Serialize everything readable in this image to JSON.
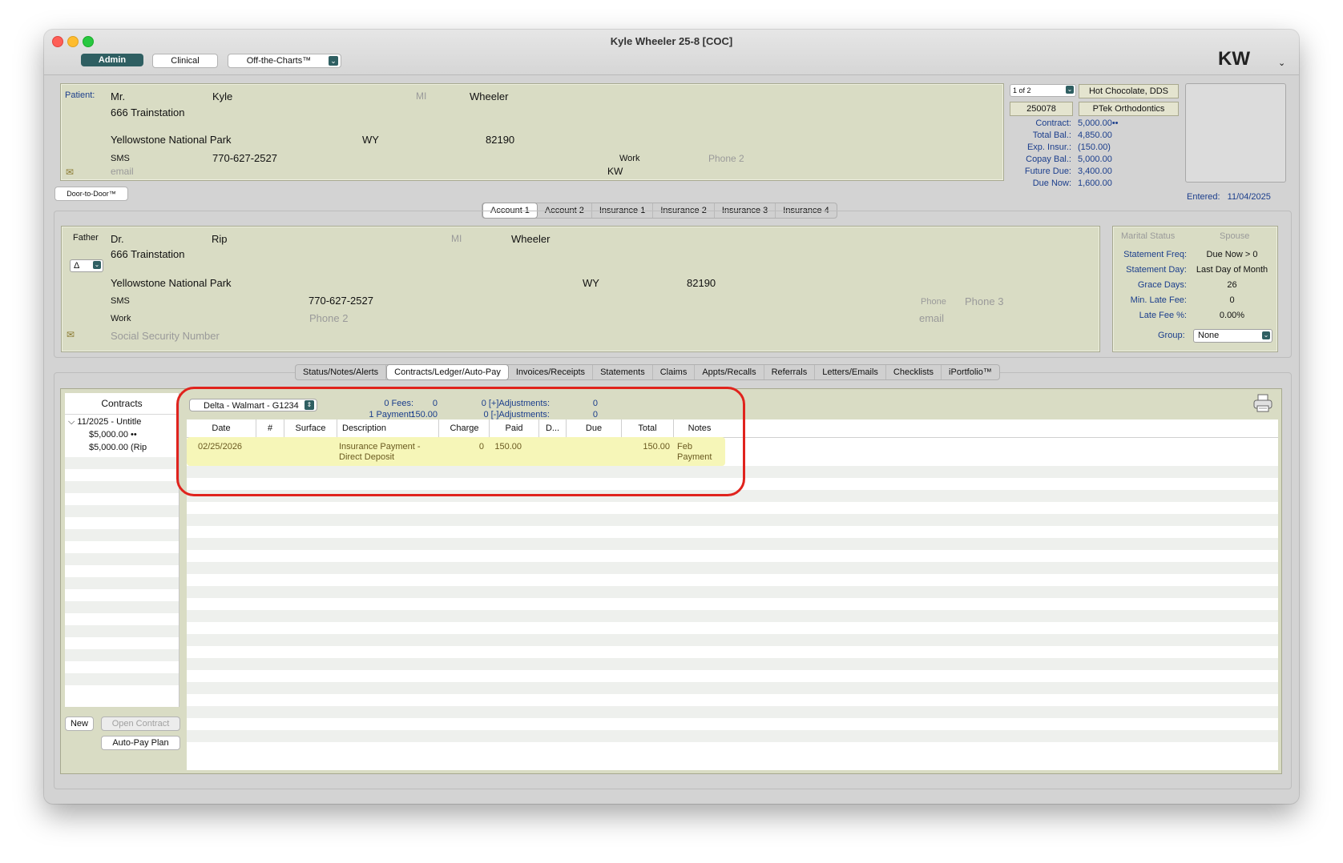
{
  "window": {
    "title": "Kyle Wheeler 25-8 [COC]",
    "initials": "KW"
  },
  "toolbar": {
    "admin": "Admin",
    "clinical": "Clinical",
    "otc": "Off-the-Charts™"
  },
  "patient": {
    "label": "Patient:",
    "prefix": "Mr.",
    "first": "Kyle",
    "mi": "MI",
    "last": "Wheeler",
    "address1": "666 Trainstation",
    "city": "Yellowstone National Park",
    "state": "WY",
    "zip": "82190",
    "sms_label": "SMS",
    "sms": "770-627-2527",
    "work_label": "Work",
    "phone2": "Phone 2",
    "email": "email",
    "initials": "KW"
  },
  "door_button": "Door-to-Door™",
  "account_info": {
    "count": "1 of 2",
    "account_no": "250078",
    "doctor": "Hot Chocolate, DDS",
    "practice": "PTek Orthodontics",
    "rows": [
      {
        "label": "Contract:",
        "value": "5,000.00••"
      },
      {
        "label": "Total Bal.:",
        "value": "4,850.00"
      },
      {
        "label": "Exp. Insur.:",
        "value": "(150.00)"
      },
      {
        "label": "Copay Bal.:",
        "value": "5,000.00"
      },
      {
        "label": "Future Due:",
        "value": "3,400.00"
      },
      {
        "label": "Due Now:",
        "value": "1,600.00"
      }
    ],
    "entered_label": "Entered:",
    "entered": "11/04/2025"
  },
  "account_tabs": [
    "Account 1",
    "Account 2",
    "Insurance 1",
    "Insurance 2",
    "Insurance 3",
    "Insurance 4"
  ],
  "responsible": {
    "relation": "Father",
    "prefix": "Dr.",
    "first": "Rip",
    "mi": "MI",
    "last": "Wheeler",
    "address1": "666 Trainstation",
    "delta": "Δ",
    "city": "Yellowstone National Park",
    "state": "WY",
    "zip": "82190",
    "sms_label": "SMS",
    "sms": "770-627-2527",
    "work_label": "Work",
    "phone2": "Phone 2",
    "phone_label": "Phone",
    "phone3": "Phone 3",
    "email": "email",
    "ssn": "Social Security Number"
  },
  "statement": {
    "marital": "Marital Status",
    "spouse": "Spouse",
    "rows": [
      {
        "label": "Statement Freq:",
        "value": "Due Now > 0"
      },
      {
        "label": "Statement Day:",
        "value": "Last Day of Month"
      },
      {
        "label": "Grace Days:",
        "value": "26"
      },
      {
        "label": "Min. Late Fee:",
        "value": "0"
      },
      {
        "label": "Late Fee %:",
        "value": "0.00%"
      }
    ],
    "group_label": "Group:",
    "group": "None"
  },
  "main_tabs": [
    "Status/Notes/Alerts",
    "Contracts/Ledger/Auto-Pay",
    "Invoices/Receipts",
    "Statements",
    "Claims",
    "Appts/Recalls",
    "Referrals",
    "Letters/Emails",
    "Checklists",
    "iPortfolio™"
  ],
  "contracts": {
    "header": "Contracts",
    "items": [
      "11/2025 - Untitle",
      "$5,000.00 ••",
      "$5,000.00 (Rip"
    ],
    "new": "New",
    "open": "Open Contract",
    "autopay": "Auto-Pay Plan"
  },
  "ledger": {
    "insurance": "Delta - Walmart - G1234",
    "fees_label": "0 Fees:",
    "fees": "0",
    "payment_label": "1 Payment:",
    "payment": "150.00",
    "adj_plus_label": "0 [+]Adjustments:",
    "adj_plus": "0",
    "adj_minus_label": "0 [-]Adjustments:",
    "adj_minus": "0",
    "columns": [
      "Date",
      "#",
      "Surface",
      "Description",
      "Charge",
      "Paid",
      "D...",
      "Due",
      "Total",
      "Notes"
    ],
    "row": {
      "date": "02/25/2026",
      "description": "Insurance Payment - Direct Deposit",
      "charge": "0",
      "paid": "150.00",
      "total": "150.00",
      "notes": "Feb Payment"
    }
  },
  "colors": {
    "accent": "#2f5f62",
    "panel": "#d9dcc4",
    "highlight": "#f6f6b8",
    "annotation": "#e0231d"
  }
}
